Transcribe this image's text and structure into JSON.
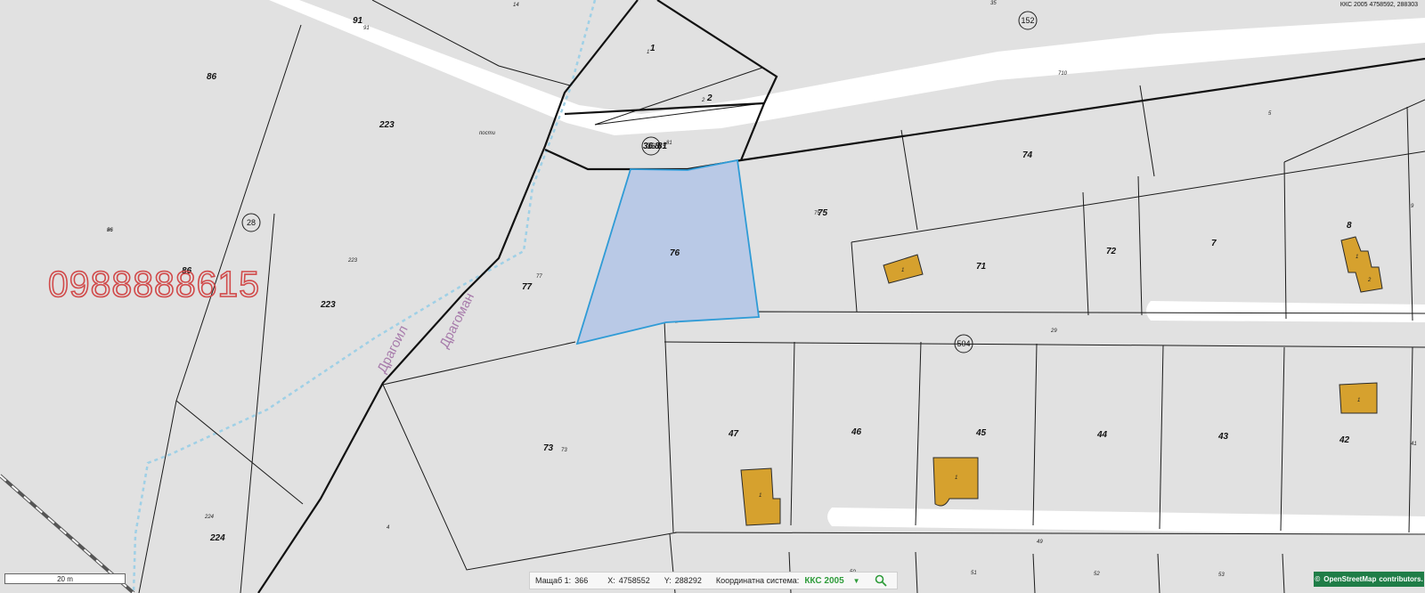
{
  "header": {
    "coord_readout": "ККС 2005 4758592, 288303"
  },
  "overlay": {
    "phone_number": "0988888615"
  },
  "road_names": [
    "Драгоил",
    "Драгоман"
  ],
  "parcel_labels": [
    {
      "text": "91",
      "small": "91"
    },
    {
      "text": "86"
    },
    {
      "text": "223",
      "small": "223"
    },
    {
      "text": "86",
      "small": "86"
    },
    {
      "text": "223"
    },
    {
      "text": "77",
      "small": "77"
    },
    {
      "text": "76"
    },
    {
      "text": "75",
      "small": "75"
    },
    {
      "text": "74"
    },
    {
      "text": "71"
    },
    {
      "text": "72"
    },
    {
      "text": "7"
    },
    {
      "text": "8"
    },
    {
      "text": "73",
      "small": "73"
    },
    {
      "text": "47"
    },
    {
      "text": "46"
    },
    {
      "text": "45"
    },
    {
      "text": "44"
    },
    {
      "text": "43"
    },
    {
      "text": "42"
    },
    {
      "text": "224"
    },
    {
      "text": "1"
    },
    {
      "text": "2"
    },
    {
      "text": "36"
    },
    {
      "text": "8"
    },
    {
      "text": "81"
    }
  ],
  "small_labels": [
    "14",
    "35",
    "710",
    "5",
    "9",
    "29",
    "41",
    "49",
    "50",
    "51",
    "52",
    "53",
    "224",
    "4",
    "1",
    "2",
    "1",
    "1",
    "1",
    "1",
    "1",
    "2",
    "1",
    "1",
    "81",
    "пости",
    "96"
  ],
  "circled_labels": [
    "152",
    "28",
    "504",
    "36"
  ],
  "scale_bar": {
    "label": "20 m"
  },
  "status_bar": {
    "scale_label": "Мащаб 1:",
    "scale_value": "366",
    "x_label": "X:",
    "x_value": "4758552",
    "y_label": "Y:",
    "y_value": "288292",
    "crs_label": "Координатна система:",
    "crs_value": "ККС 2005",
    "dropdown_icon": "chevron-down-icon",
    "search_icon": "search-icon"
  },
  "attribution": {
    "symbol": "©",
    "text": "OpenStreetMap",
    "suffix": "contributors."
  },
  "colors": {
    "selected_fill": "#b9c9e6",
    "selected_stroke": "#2f9bd6",
    "building": "#d6a12e",
    "stream": "#9fd0e6",
    "phone_watermark": "#d14a4a",
    "road_name": "#a77bab",
    "crs_green": "#2e9c3a",
    "attribution_bg": "#1f7d47"
  }
}
